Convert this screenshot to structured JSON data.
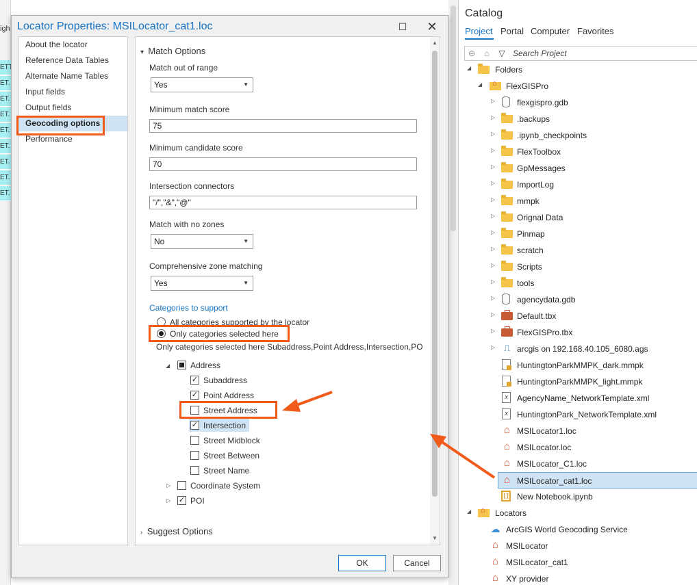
{
  "background": {
    "tab_label": "igh",
    "cells": [
      "ETT",
      "ET.",
      "ET.",
      "ET.",
      "ET.",
      "ET.",
      "ET.",
      "ET.",
      "ET."
    ]
  },
  "dialog": {
    "title": "Locator Properties: MSILocator_cat1.loc",
    "nav_items": [
      {
        "label": "About the locator",
        "active": false
      },
      {
        "label": "Reference Data Tables",
        "active": false
      },
      {
        "label": "Alternate Name Tables",
        "active": false
      },
      {
        "label": "Input fields",
        "active": false
      },
      {
        "label": "Output fields",
        "active": false
      },
      {
        "label": "Geocoding options",
        "active": true
      },
      {
        "label": "Performance",
        "active": false
      }
    ],
    "match_options": {
      "header": "Match Options",
      "match_out_of_range_label": "Match out of range",
      "match_out_of_range_value": "Yes",
      "min_match_score_label": "Minimum match score",
      "min_match_score_value": "75",
      "min_candidate_score_label": "Minimum candidate score",
      "min_candidate_score_value": "70",
      "intersection_connectors_label": "Intersection connectors",
      "intersection_connectors_value": "\"/\",\"&\",\"@\"",
      "match_no_zones_label": "Match with no zones",
      "match_no_zones_value": "No",
      "comprehensive_zone_label": "Comprehensive zone matching",
      "comprehensive_zone_value": "Yes"
    },
    "categories": {
      "header": "Categories to support",
      "radio_all": "All categories supported by the locator",
      "radio_selected": "Only categories selected here",
      "summary": "Only categories selected here Subaddress,Point Address,Intersection,PO",
      "address_label": "Address",
      "items": [
        {
          "label": "Subaddress",
          "checked": true
        },
        {
          "label": "Point Address",
          "checked": true
        },
        {
          "label": "Street Address",
          "checked": false
        },
        {
          "label": "Intersection",
          "checked": true
        },
        {
          "label": "Street Midblock",
          "checked": false
        },
        {
          "label": "Street Between",
          "checked": false
        },
        {
          "label": "Street Name",
          "checked": false
        }
      ],
      "coordinate_system_label": "Coordinate System",
      "poi_label": "POI"
    },
    "suggest_options_header": "Suggest Options",
    "ok_label": "OK",
    "cancel_label": "Cancel"
  },
  "catalog": {
    "title": "Catalog",
    "tabs": [
      "Project",
      "Portal",
      "Computer",
      "Favorites"
    ],
    "search_placeholder": "Search Project",
    "tree": [
      {
        "label": "Folders",
        "icon": "folder-group-icon"
      },
      {
        "label": "FlexGISPro",
        "icon": "home-folder-icon"
      },
      {
        "label": "flexgispro.gdb",
        "icon": "geodatabase-icon"
      },
      {
        "label": ".backups",
        "icon": "folder-icon"
      },
      {
        "label": ".ipynb_checkpoints",
        "icon": "folder-icon"
      },
      {
        "label": "FlexToolbox",
        "icon": "folder-icon"
      },
      {
        "label": "GpMessages",
        "icon": "folder-icon"
      },
      {
        "label": "ImportLog",
        "icon": "folder-icon"
      },
      {
        "label": "mmpk",
        "icon": "folder-icon"
      },
      {
        "label": "Orignal Data",
        "icon": "folder-icon"
      },
      {
        "label": "Pinmap",
        "icon": "folder-icon"
      },
      {
        "label": "scratch",
        "icon": "folder-icon"
      },
      {
        "label": "Scripts",
        "icon": "folder-icon"
      },
      {
        "label": "tools",
        "icon": "folder-icon"
      },
      {
        "label": "agencydata.gdb",
        "icon": "geodatabase-icon"
      },
      {
        "label": "Default.tbx",
        "icon": "toolbox-icon"
      },
      {
        "label": "FlexGISPro.tbx",
        "icon": "toolbox-icon"
      },
      {
        "label": "arcgis on 192.168.40.105_6080.ags",
        "icon": "server-icon"
      },
      {
        "label": "HuntingtonParkMMPK_dark.mmpk",
        "icon": "mmpk-icon"
      },
      {
        "label": "HuntingtonParkMMPK_light.mmpk",
        "icon": "mmpk-icon"
      },
      {
        "label": "AgencyName_NetworkTemplate.xml",
        "icon": "xml-icon"
      },
      {
        "label": "HuntingtonPark_NetworkTemplate.xml",
        "icon": "xml-icon"
      },
      {
        "label": "MSILocator1.loc",
        "icon": "locator-icon"
      },
      {
        "label": "MSILocator.loc",
        "icon": "locator-icon"
      },
      {
        "label": "MSILocator_C1.loc",
        "icon": "locator-icon"
      },
      {
        "label": "MSILocator_cat1.loc",
        "icon": "locator-icon"
      },
      {
        "label": "New Notebook.ipynb",
        "icon": "notebook-icon"
      },
      {
        "label": "Locators",
        "icon": "locators-folder-icon"
      },
      {
        "label": "ArcGIS World Geocoding Service",
        "icon": "globe-locator-icon"
      },
      {
        "label": "MSILocator",
        "icon": "locator-icon"
      },
      {
        "label": "MSILocator_cat1",
        "icon": "locator-icon"
      },
      {
        "label": "XY provider",
        "icon": "locator-icon"
      }
    ]
  },
  "colors": {
    "accent": "#1673c4",
    "annotation": "#f05a1a",
    "selection": "#cfe3f5"
  }
}
